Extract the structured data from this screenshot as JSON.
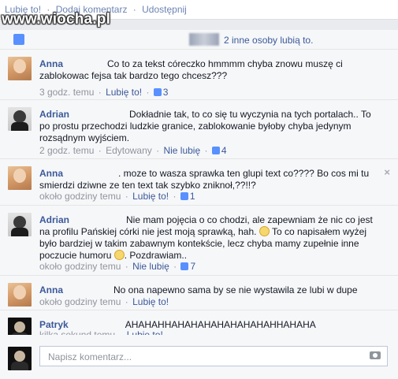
{
  "watermark": "www.wiocha.pl",
  "post_actions": [
    "Lubię to!",
    "·",
    "Dodaj komentarz",
    "·",
    "Udostępnij"
  ],
  "likes_summary": "2 inne osoby lubią to.",
  "comments": [
    {
      "author": "Anna",
      "text": "Co to za tekst córeczko hmmmm chyba znowu muszę ci zablokowac fejsa tak bardzo tego chcesz???",
      "time": "3 godz. temu",
      "like_label": "Lubię to!",
      "like_count": "3"
    },
    {
      "author": "Adrian",
      "text": "Dokładnie tak, to co się tu wyczynia na tych portalach.. To po prostu przechodzi ludzkie granice, zablokowanie byłoby chyba jedynym rozsądnym wyjściem.",
      "time": "2 godz. temu",
      "edited": "Edytowany",
      "like_label": "Nie lubię",
      "like_count": "4"
    },
    {
      "author": "Anna",
      "text": ". moze to wasza sprawka ten glupi text co???? Bo cos mi tu smierdzi dziwne ze ten text tak szybko zniknoł,??!!?",
      "time": "około godziny temu",
      "like_label": "Lubię to!",
      "like_count": "1",
      "close": "×"
    },
    {
      "author": "Adrian",
      "text_part1": "Nie mam pojęcia o co chodzi, ale zapewniam że nic co jest na profilu Pańskiej córki nie jest moją sprawką, hah.",
      "text_part2": "To co napisałem wyżej było bardziej w takim zabawnym kontekście, lecz chyba mamy zupełnie inne poczucie humoru",
      "text_part3": ". Pozdrawiam..",
      "time": "około godziny temu",
      "like_label": "Nie lubię",
      "like_count": "7"
    },
    {
      "author": "Anna",
      "text": "No ona napewno sama by se nie wystawila ze lubi w dupe",
      "time": "około godziny temu",
      "like_label": "Lubię to!"
    },
    {
      "author": "Patryk",
      "text": "AHAHAHHAHAHAHAHAHAHAHAHHAHAHA",
      "time": "kilka sekund temu",
      "like_label": "Lubię to!"
    }
  ],
  "comment_input": {
    "placeholder": "Napisz komentarz..."
  },
  "separator": "·",
  "colors": {
    "link": "#3b5998",
    "meta": "#90949c",
    "background": "#f6f7f9",
    "like_blue": "#5890ff"
  },
  "icons": [
    "thumbs-up-icon",
    "close-icon",
    "camera-icon",
    "smiley-icon"
  ]
}
